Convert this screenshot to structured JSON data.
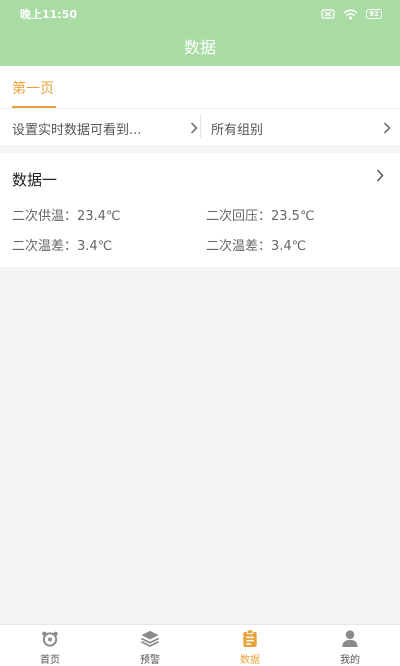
{
  "status_bar": {
    "time": "晚上11:50",
    "battery": "92"
  },
  "header": {
    "title": "数据"
  },
  "tabs": [
    {
      "label": "第一页",
      "active": true
    }
  ],
  "filters": {
    "left": "设置实时数据可看到...",
    "right": "所有组别"
  },
  "data_card": {
    "title": "数据一",
    "metrics": [
      "二次供温：23.4℃",
      "二次回压：23.5℃",
      "二次温差：3.4℃",
      "二次温差：3.4℃"
    ]
  },
  "bottom_nav": {
    "items": [
      {
        "label": "首页",
        "icon": "home-icon"
      },
      {
        "label": "预警",
        "icon": "layers-icon"
      },
      {
        "label": "数据",
        "icon": "clipboard-icon",
        "active": true
      },
      {
        "label": "我的",
        "icon": "user-icon"
      }
    ]
  },
  "colors": {
    "header": "#a9dba4",
    "accent": "#e8a23a",
    "background": "#f4f4f4"
  }
}
